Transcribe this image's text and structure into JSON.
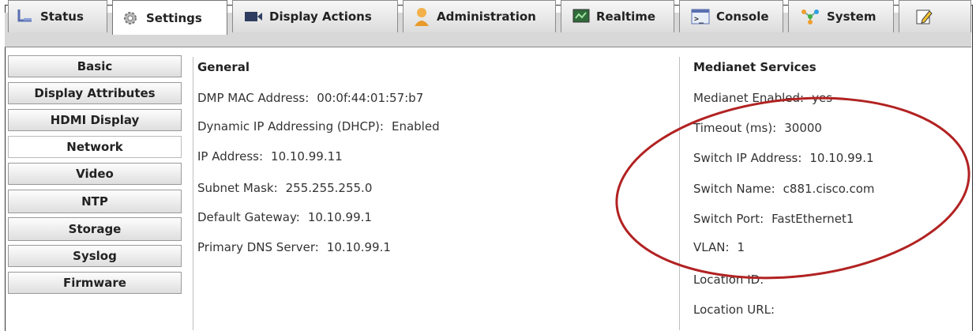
{
  "tabs": [
    {
      "label": "Status",
      "icon": "status-icon",
      "active": false
    },
    {
      "label": "Settings",
      "icon": "gear-icon",
      "active": true
    },
    {
      "label": "Display Actions",
      "icon": "film-icon",
      "active": false
    },
    {
      "label": "Administration",
      "icon": "person-icon",
      "active": false
    },
    {
      "label": "Realtime",
      "icon": "monitor-icon",
      "active": false
    },
    {
      "label": "Console",
      "icon": "terminal-icon",
      "active": false
    },
    {
      "label": "System",
      "icon": "network-icon",
      "active": false
    },
    {
      "label": "",
      "icon": "edit-icon",
      "active": false
    }
  ],
  "sidebar": {
    "items": [
      {
        "label": "Basic"
      },
      {
        "label": "Display Attributes"
      },
      {
        "label": "HDMI Display"
      },
      {
        "label": "Network",
        "active": true
      },
      {
        "label": "Video"
      },
      {
        "label": "NTP"
      },
      {
        "label": "Storage"
      },
      {
        "label": "Syslog"
      },
      {
        "label": "Firmware"
      }
    ]
  },
  "general": {
    "title": "General",
    "rows": [
      {
        "label": "DMP MAC Address:",
        "value": "00:0f:44:01:57:b7"
      },
      {
        "label": "Dynamic IP Addressing (DHCP):",
        "value": "Enabled"
      },
      {
        "label": "IP Address:",
        "value": "10.10.99.11"
      },
      {
        "label": "Subnet Mask:",
        "value": "255.255.255.0"
      },
      {
        "label": "Default Gateway:",
        "value": "10.10.99.1"
      },
      {
        "label": "Primary DNS Server:",
        "value": "10.10.99.1"
      }
    ]
  },
  "medianet": {
    "title": "Medianet Services",
    "rows": [
      {
        "label": "Medianet Enabled:",
        "value": "yes"
      },
      {
        "label": "Timeout (ms):",
        "value": "30000"
      },
      {
        "label": "Switch IP Address:",
        "value": "10.10.99.1"
      },
      {
        "label": "Switch Name:",
        "value": "c881.cisco.com"
      },
      {
        "label": "Switch Port:",
        "value": "FastEthernet1"
      },
      {
        "label": "VLAN:",
        "value": "1"
      },
      {
        "label": "Location ID:",
        "value": ""
      },
      {
        "label": "Location URL:",
        "value": ""
      }
    ]
  },
  "colors": {
    "highlight_ellipse": "#b22222",
    "tab_bg": "#d8d8d8"
  }
}
